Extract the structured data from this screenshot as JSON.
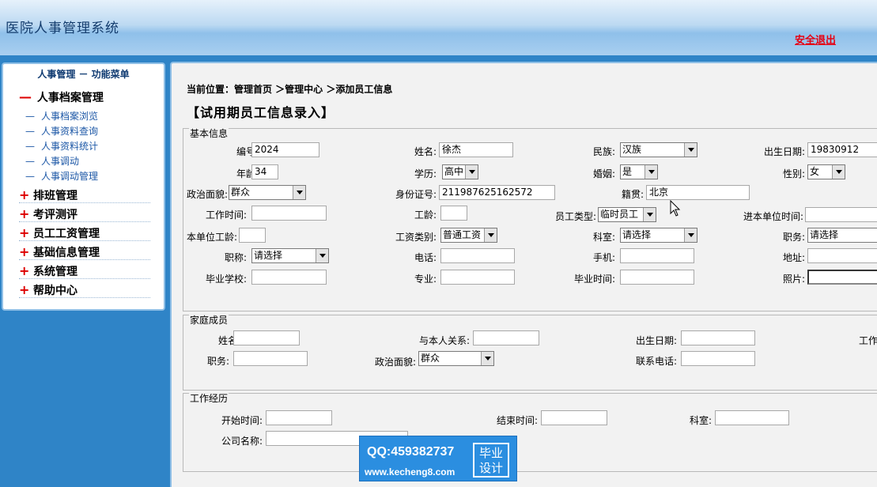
{
  "header": {
    "title": "医院人事管理系统",
    "logout": "安全退出"
  },
  "sidebar": {
    "title": "人事管理 － 功能菜单",
    "sections": [
      {
        "sign": "—",
        "label": "人事档案管理"
      },
      {
        "sign": "+",
        "label": "排班管理"
      },
      {
        "sign": "+",
        "label": "考评测评"
      },
      {
        "sign": "+",
        "label": "员工工资管理"
      },
      {
        "sign": "+",
        "label": "基础信息管理"
      },
      {
        "sign": "+",
        "label": "系统管理"
      },
      {
        "sign": "+",
        "label": "帮助中心"
      }
    ],
    "sub_items": [
      "人事档案浏览",
      "人事资料查询",
      "人事资料统计",
      "人事调动",
      "人事调动管理"
    ],
    "sub_dash": "—"
  },
  "main": {
    "breadcrumb": "当前位置：管理首页 ＞管理中心 ＞添加员工信息",
    "page_title": "【试用期员工信息录入】"
  },
  "basic": {
    "legend": "基本信息",
    "labels": {
      "code": "编号:",
      "name": "姓名:",
      "nation": "民族:",
      "birth": "出生日期:",
      "age": "年龄:",
      "edu": "学历:",
      "marriage": "婚姻:",
      "gender": "性别:",
      "political": "政治面貌:",
      "idno": "身份证号:",
      "native": "籍贯:",
      "worktime": "工作时间:",
      "seniority": "工龄:",
      "emptype": "员工类型:",
      "jointime": "进本单位时间:",
      "unitage": "本单位工龄:",
      "wagetype": "工资类别:",
      "dept": "科室:",
      "duty": "职务:",
      "title": "职称:",
      "phone": "电话:",
      "mobile": "手机:",
      "address": "地址:",
      "school": "毕业学校:",
      "major": "专业:",
      "gradtime": "毕业时间:",
      "photo": "照片:"
    },
    "values": {
      "code": "2024",
      "name": "徐杰",
      "nation": "汉族",
      "birth": "19830912",
      "age": "34",
      "edu": "高中",
      "marriage": "是",
      "gender": "女",
      "political": "群众",
      "idno": "211987625162572",
      "native": "北京",
      "emptype": "临时员工",
      "wagetype": "普通工资",
      "dept": "请选择",
      "duty": "请选择",
      "title": "请选择"
    }
  },
  "family": {
    "legend": "家庭成员",
    "labels": {
      "name": "姓名:",
      "relation": "与本人关系:",
      "birth": "出生日期:",
      "work": "工作",
      "duty": "职务:",
      "political": "政治面貌:",
      "phone": "联系电话:"
    },
    "values": {
      "political": "群众"
    }
  },
  "experience": {
    "legend": "工作经历",
    "labels": {
      "start": "开始时间:",
      "end": "结束时间:",
      "dept": "科室:",
      "company": "公司名称:"
    }
  },
  "watermark": {
    "qq": "QQ:459382737",
    "url": "www.kecheng8.com",
    "badge_line1": "毕业",
    "badge_line2": "设计"
  }
}
